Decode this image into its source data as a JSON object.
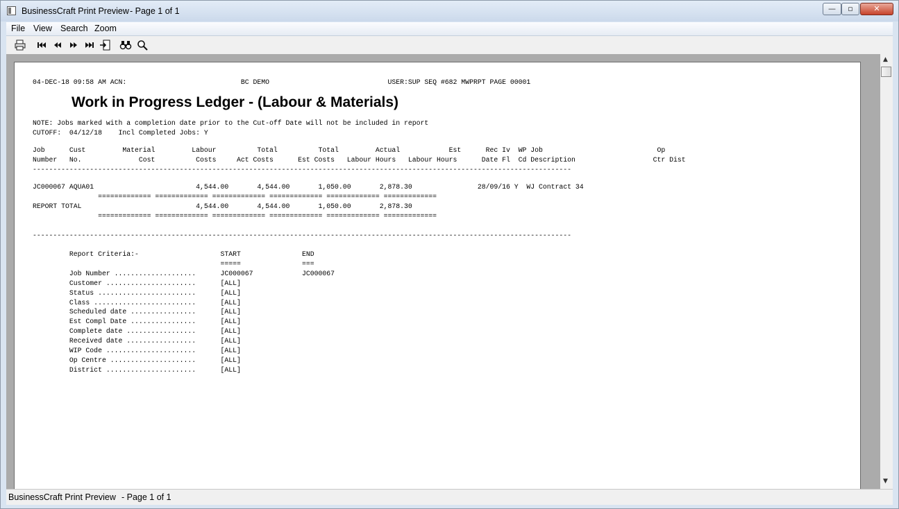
{
  "window": {
    "title": "BusinessCraft Print Preview",
    "page_indicator": "- Page 1 of 1",
    "minimize_glyph": "—",
    "maximize_glyph": "▫",
    "close_glyph": "✕"
  },
  "menu": [
    "File",
    "View",
    "Search",
    "Zoom"
  ],
  "toolbar": {
    "icons": [
      "printer-icon",
      "first-page-icon",
      "previous-page-icon",
      "next-page-icon",
      "last-page-icon",
      "go-to-page-icon",
      "find-icon",
      "zoom-icon"
    ]
  },
  "report": {
    "header_line": "04-DEC-18 09:58 AM ACN:                            BC DEMO                             USER:SUP SEQ #682 MWPRPT PAGE 00001",
    "title": "Work in Progress Ledger - (Labour & Materials)",
    "note": "NOTE: Jobs marked with a completion date prior to the Cut-off Date will not be included in report",
    "cutoff": "CUTOFF:  04/12/18    Incl Completed Jobs: Y",
    "col_header_1": "Job      Cust         Material         Labour          Total          Total         Actual            Est      Rec Iv  WP Job                            Op",
    "col_header_2": "Number   No.              Cost          Costs     Act Costs      Est Costs   Labour Hours   Labour Hours      Date Fl  Cd Description                   Ctr Dist",
    "rule_1": "------------------------------------------------------------------------------------------------------------------------------------",
    "job_row": "JC000067 AQUA01                         4,544.00       4,544.00       1,050.00       2,878.30                28/09/16 Y  WJ Contract 34",
    "eq_line_1": "                ============= ============= ============= ============= ============= =============",
    "total_row": "REPORT TOTAL                            4,544.00       4,544.00       1,050.00       2,878.30",
    "eq_line_2": "                ============= ============= ============= ============= ============= =============",
    "rule_2": "------------------------------------------------------------------------------------------------------------------------------------",
    "criteria_header": "         Report Criteria:-                    START               END",
    "criteria_underline": "                                              =====               ===",
    "criteria": [
      "         Job Number ....................      JC000067            JC000067",
      "         Customer ......................      [ALL]",
      "         Status ........................      [ALL]",
      "         Class .........................      [ALL]",
      "         Scheduled date ................      [ALL]",
      "         Est Compl Date ................      [ALL]",
      "         Complete date .................      [ALL]",
      "         Received date .................      [ALL]",
      "         WIP Code ......................      [ALL]",
      "         Op Centre .....................      [ALL]",
      "         District ......................      [ALL]"
    ]
  },
  "status": {
    "text": "BusinessCraft Print Preview",
    "page": "- Page 1 of 1"
  }
}
